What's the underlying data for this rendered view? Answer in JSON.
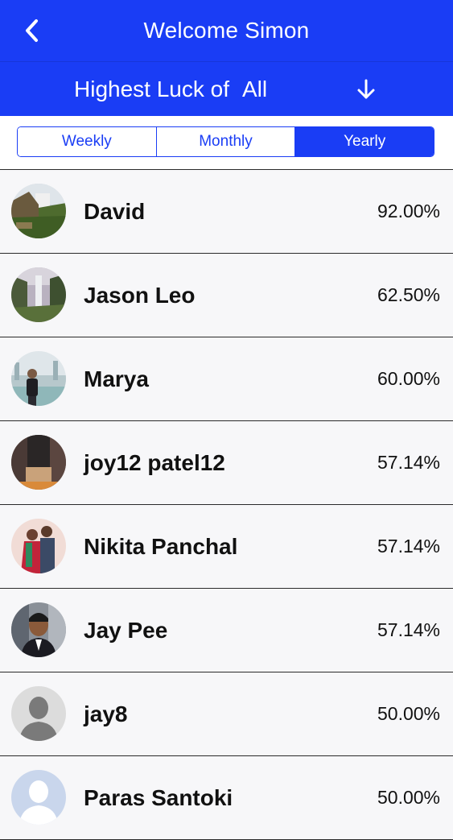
{
  "header": {
    "title": "Welcome Simon",
    "back_icon": "chevron-left-icon"
  },
  "filter": {
    "prefix": "Highest Luck of",
    "value": "All",
    "arrow_icon": "arrow-down-icon"
  },
  "segments": [
    {
      "label": "Weekly",
      "active": false
    },
    {
      "label": "Monthly",
      "active": false
    },
    {
      "label": "Yearly",
      "active": true
    }
  ],
  "players": [
    {
      "name": "David",
      "luck": "92.00%"
    },
    {
      "name": "Jason Leo",
      "luck": "62.50%"
    },
    {
      "name": "Marya",
      "luck": "60.00%"
    },
    {
      "name": "joy12 patel12",
      "luck": "57.14%"
    },
    {
      "name": "Nikita Panchal",
      "luck": "57.14%"
    },
    {
      "name": "Jay Pee",
      "luck": "57.14%"
    },
    {
      "name": "jay8",
      "luck": "50.00%"
    },
    {
      "name": "Paras Santoki",
      "luck": "50.00%"
    }
  ],
  "colors": {
    "primary": "#1a3df5",
    "background": "#f7f7f9",
    "divider": "#2a2a2a"
  }
}
